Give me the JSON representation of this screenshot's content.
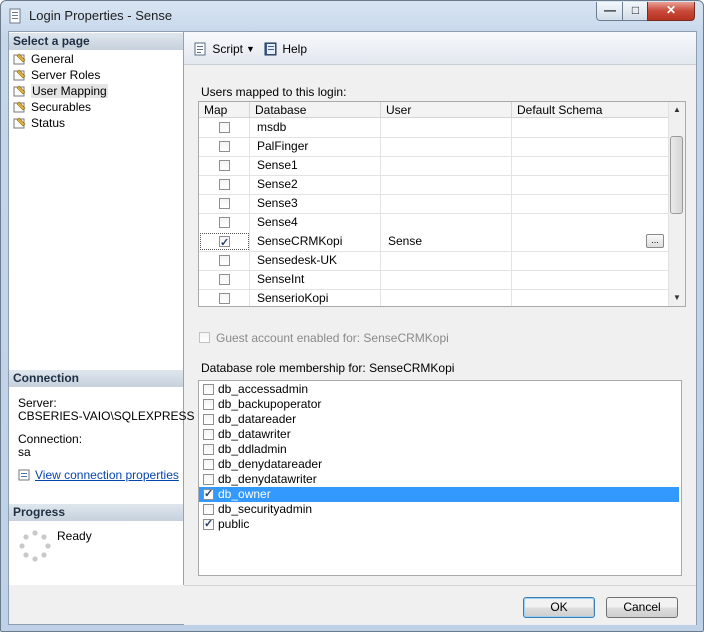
{
  "window": {
    "title": "Login Properties - Sense",
    "controls": {
      "minimize": "—",
      "maximize": "□",
      "close": "✕"
    }
  },
  "left": {
    "select_page_header": "Select a page",
    "pages": [
      {
        "label": "General",
        "icon": "wrench-page-icon"
      },
      {
        "label": "Server Roles",
        "icon": "wrench-page-icon"
      },
      {
        "label": "User Mapping",
        "icon": "wrench-page-icon",
        "selected": true
      },
      {
        "label": "Securables",
        "icon": "wrench-page-icon"
      },
      {
        "label": "Status",
        "icon": "wrench-page-icon"
      }
    ],
    "connection_header": "Connection",
    "server_label": "Server:",
    "server_value": "CBSERIES-VAIO\\SQLEXPRESS",
    "connection_label": "Connection:",
    "connection_value": "sa",
    "view_connection_link": "View connection properties",
    "progress_header": "Progress",
    "progress_status": "Ready"
  },
  "toolbar": {
    "script_label": "Script",
    "help_label": "Help"
  },
  "users_mapped": {
    "label": "Users mapped to this login:",
    "columns": [
      "Map",
      "Database",
      "User",
      "Default Schema"
    ],
    "rows": [
      {
        "map": false,
        "database": "msdb",
        "user": "",
        "schema": ""
      },
      {
        "map": false,
        "database": "PalFinger",
        "user": "",
        "schema": ""
      },
      {
        "map": false,
        "database": "Sense1",
        "user": "",
        "schema": ""
      },
      {
        "map": false,
        "database": "Sense2",
        "user": "",
        "schema": ""
      },
      {
        "map": false,
        "database": "Sense3",
        "user": "",
        "schema": ""
      },
      {
        "map": false,
        "database": "Sense4",
        "user": "",
        "schema": ""
      },
      {
        "map": true,
        "database": "SenseCRMKopi",
        "user": "Sense",
        "schema": ""
      },
      {
        "map": false,
        "database": "Sensedesk-UK",
        "user": "",
        "schema": ""
      },
      {
        "map": false,
        "database": "SenseInt",
        "user": "",
        "schema": ""
      },
      {
        "map": false,
        "database": "SenserioKopi",
        "user": "",
        "schema": ""
      }
    ],
    "ellipsis": "..."
  },
  "guest_account_label": "Guest account enabled for: SenseCRMKopi",
  "role_membership": {
    "label": "Database role membership for: SenseCRMKopi",
    "roles": [
      {
        "name": "db_accessadmin",
        "checked": false
      },
      {
        "name": "db_backupoperator",
        "checked": false
      },
      {
        "name": "db_datareader",
        "checked": false
      },
      {
        "name": "db_datawriter",
        "checked": false
      },
      {
        "name": "db_ddladmin",
        "checked": false
      },
      {
        "name": "db_denydatareader",
        "checked": false
      },
      {
        "name": "db_denydatawriter",
        "checked": false
      },
      {
        "name": "db_owner",
        "checked": true,
        "selected": true
      },
      {
        "name": "db_securityadmin",
        "checked": false
      },
      {
        "name": "public",
        "checked": true
      }
    ]
  },
  "buttons": {
    "ok": "OK",
    "cancel": "Cancel"
  }
}
